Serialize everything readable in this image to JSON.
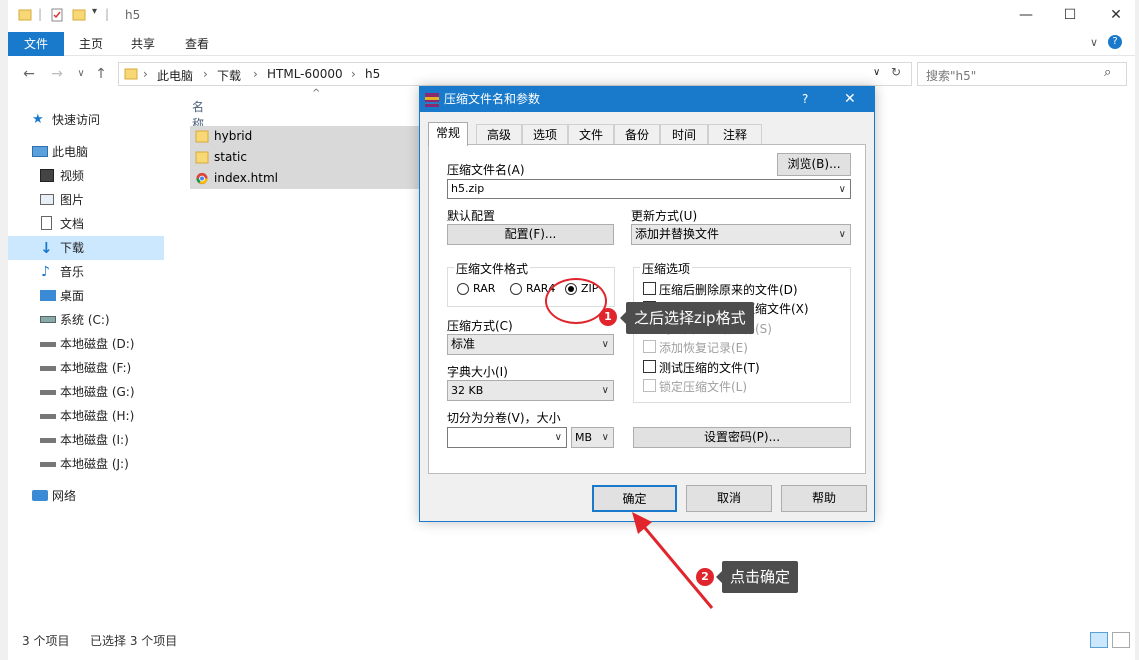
{
  "window": {
    "title": "h5"
  },
  "ribbon": {
    "tabs": [
      "文件",
      "主页",
      "共享",
      "查看"
    ]
  },
  "address": {
    "crumbs": [
      "此电脑",
      "下载",
      "HTML-60000",
      "h5"
    ]
  },
  "search": {
    "placeholder": "搜索\"h5\""
  },
  "nav": {
    "quick_access": "快速访问",
    "this_pc": "此电脑",
    "items": [
      "视频",
      "图片",
      "文档",
      "下载",
      "音乐",
      "桌面",
      "系统 (C:)",
      "本地磁盘 (D:)",
      "本地磁盘 (F:)",
      "本地磁盘 (G:)",
      "本地磁盘 (H:)",
      "本地磁盘 (I:)",
      "本地磁盘 (J:)"
    ],
    "network": "网络",
    "selected": "下载"
  },
  "files": {
    "column_name": "名称",
    "rows": [
      {
        "name": "hybrid",
        "icon": "folder-icon"
      },
      {
        "name": "static",
        "icon": "folder-icon"
      },
      {
        "name": "index.html",
        "icon": "chrome-icon"
      }
    ]
  },
  "status": {
    "count": "3 个项目",
    "selected": "已选择 3 个项目"
  },
  "dialog": {
    "title": "压缩文件名和参数",
    "help_symbol": "?",
    "tabs": [
      "常规",
      "高级",
      "选项",
      "文件",
      "备份",
      "时间",
      "注释"
    ],
    "archive_name_label": "压缩文件名(A)",
    "archive_name_value": "h5.zip",
    "browse_button": "浏览(B)...",
    "default_profile_label": "默认配置",
    "profile_button": "配置(F)...",
    "update_mode_label": "更新方式(U)",
    "update_mode_value": "添加并替换文件",
    "format_group": "压缩文件格式",
    "formats": [
      "RAR",
      "RAR4",
      "ZIP"
    ],
    "selected_format": "ZIP",
    "method_label": "压缩方式(C)",
    "method_value": "标准",
    "dict_label": "字典大小(I)",
    "dict_value": "32 KB",
    "split_label": "切分为分卷(V)，大小",
    "split_unit": "MB",
    "options_group": "压缩选项",
    "options": [
      {
        "label": "压缩后删除原来的文件(D)",
        "checked": false,
        "disabled": false
      },
      {
        "label": "创建自解压格式压缩文件(X)",
        "checked": false,
        "disabled": false
      },
      {
        "label": "创建固实压缩文件(S)",
        "checked": false,
        "disabled": true
      },
      {
        "label": "添加恢复记录(E)",
        "checked": false,
        "disabled": true
      },
      {
        "label": "测试压缩的文件(T)",
        "checked": false,
        "disabled": false
      },
      {
        "label": "锁定压缩文件(L)",
        "checked": false,
        "disabled": true
      }
    ],
    "password_button": "设置密码(P)...",
    "ok_button": "确定",
    "cancel_button": "取消",
    "help_button": "帮助"
  },
  "annotations": [
    {
      "number": "1",
      "text": "之后选择zip格式"
    },
    {
      "number": "2",
      "text": "点击确定"
    }
  ],
  "colors": {
    "accent": "#1979ca",
    "annotation_red": "#e0262c",
    "tooltip_bg": "#4d4d4d"
  }
}
